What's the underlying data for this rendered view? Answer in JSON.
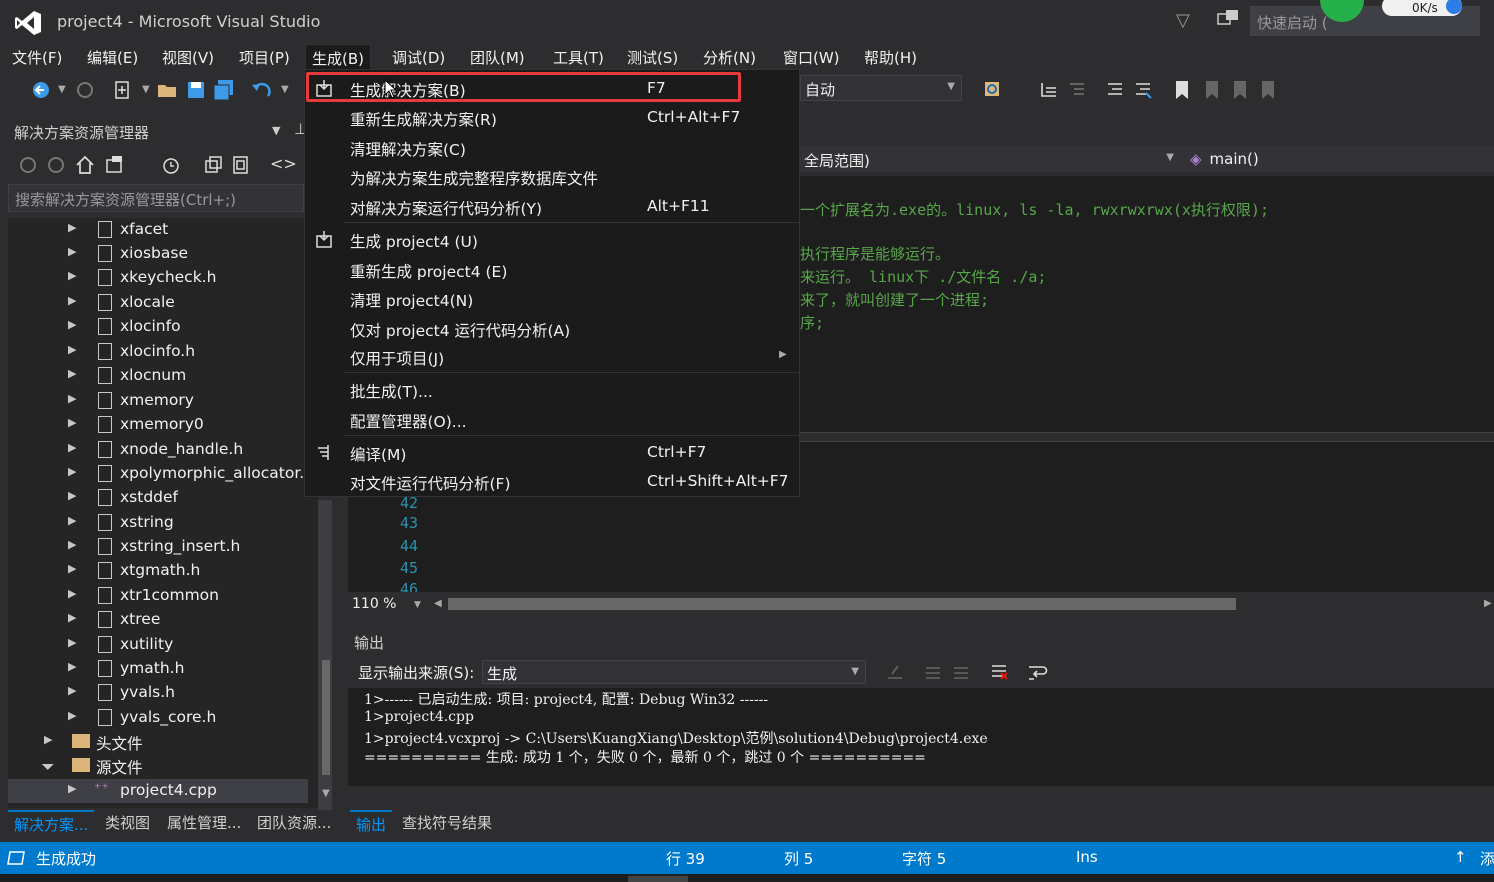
{
  "window": {
    "title": "project4 - Microsoft Visual Studio",
    "quick_launch_placeholder": "快速启动 (",
    "net_speed": "0K/s"
  },
  "menu": [
    "文件(F)",
    "编辑(E)",
    "视图(V)",
    "项目(P)",
    "生成(B)",
    "调试(D)",
    "团队(M)",
    "工具(T)",
    "测试(S)",
    "分析(N)",
    "窗口(W)",
    "帮助(H)"
  ],
  "toolbar": {
    "config_value": "自动"
  },
  "build_menu": {
    "items": [
      {
        "label": "生成解决方案(B)",
        "shortcut": "F7"
      },
      {
        "label": "重新生成解决方案(R)",
        "shortcut": "Ctrl+Alt+F7"
      },
      {
        "label": "清理解决方案(C)",
        "shortcut": ""
      },
      {
        "label": "为解决方案生成完整程序数据库文件",
        "shortcut": ""
      },
      {
        "label": "对解决方案运行代码分析(Y)",
        "shortcut": "Alt+F11"
      },
      {
        "label": "生成 project4 (U)",
        "shortcut": ""
      },
      {
        "label": "重新生成 project4 (E)",
        "shortcut": ""
      },
      {
        "label": "清理 project4(N)",
        "shortcut": ""
      },
      {
        "label": "仅对 project4 运行代码分析(A)",
        "shortcut": ""
      },
      {
        "label": "仅用于项目(J)",
        "shortcut": ""
      },
      {
        "label": "批生成(T)...",
        "shortcut": ""
      },
      {
        "label": "配置管理器(O)...",
        "shortcut": ""
      },
      {
        "label": "编译(M)",
        "shortcut": "Ctrl+F7"
      },
      {
        "label": "对文件运行代码分析(F)",
        "shortcut": "Ctrl+Shift+Alt+F7"
      }
    ]
  },
  "solution_explorer": {
    "title": "解决方案资源管理器",
    "search_placeholder": "搜索解决方案资源管理器(Ctrl+;)",
    "items": [
      "xfacet",
      "xiosbase",
      "xkeycheck.h",
      "xlocale",
      "xlocinfo",
      "xlocinfo.h",
      "xlocnum",
      "xmemory",
      "xmemory0",
      "xnode_handle.h",
      "xpolymorphic_allocator.h",
      "xstddef",
      "xstring",
      "xstring_insert.h",
      "xtgmath.h",
      "xtr1common",
      "xtree",
      "xutility",
      "ymath.h",
      "yvals.h",
      "yvals_core.h"
    ],
    "folders": [
      "头文件",
      "源文件"
    ],
    "source_file": "project4.cpp",
    "tabs": [
      "解决方案...",
      "类视图",
      "属性管理...",
      "团队资源..."
    ]
  },
  "editor": {
    "scope": "全局范围)",
    "function": "main()",
    "code_lines": [
      "一个扩展名为.exe的。linux, ls -la, rwxrwxrwx(x执行权限);",
      "执行程序是能够运行。",
      "来运行。   linux下 ./文件名    ./a;",
      "来了，就叫创建了一个进程;",
      "序;"
    ],
    "line_numbers": [
      "42",
      "43",
      "44",
      "45",
      "46"
    ],
    "zoom": "110 %"
  },
  "output": {
    "title": "输出",
    "source_label": "显示输出来源(S):",
    "source_value": "生成",
    "lines": [
      "1>------ 已启动生成: 项目: project4, 配置: Debug Win32 ------",
      "1>project4.cpp",
      "1>project4.vcxproj -> C:\\Users\\KuangXiang\\Desktop\\范例\\solution4\\Debug\\project4.exe",
      "========== 生成: 成功 1 个，失败 0 个，最新 0 个，跳过 0 个 =========="
    ],
    "tabs": [
      "输出",
      "查找符号结果"
    ]
  },
  "status": {
    "message": "生成成功",
    "line": "行 39",
    "col": "列 5",
    "char": "字符 5",
    "mode": "Ins",
    "extra": "添"
  },
  "colors": {
    "accent": "#007acc",
    "highlight": "#e83a3a",
    "comment": "#57a64a"
  }
}
